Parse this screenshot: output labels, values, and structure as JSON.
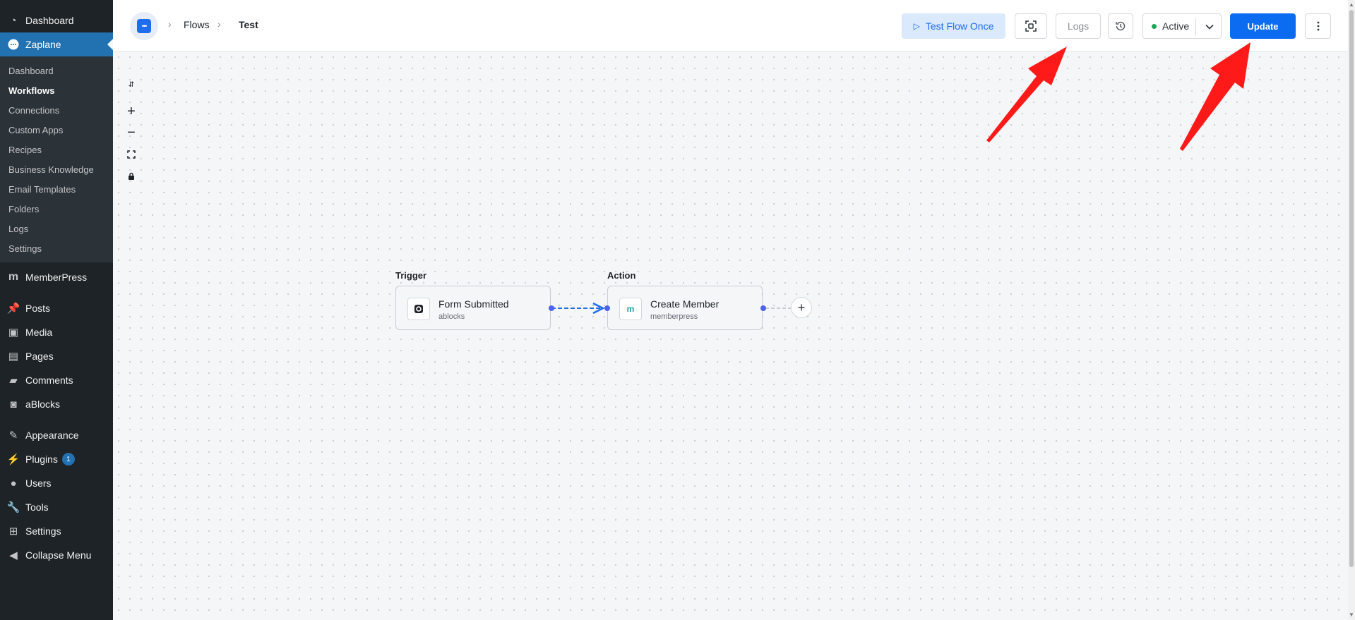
{
  "sidebar": {
    "top": [
      {
        "label": "Dashboard",
        "icon": "dashboard-icon"
      },
      {
        "label": "Zaplane",
        "icon": "zaplane-icon",
        "current": true
      }
    ],
    "submenu": [
      "Dashboard",
      "Workflows",
      "Connections",
      "Custom Apps",
      "Recipes",
      "Business Knowledge",
      "Email Templates",
      "Folders",
      "Logs",
      "Settings"
    ],
    "submenu_active": "Workflows",
    "bottom": [
      {
        "label": "MemberPress",
        "icon": "memberpress-icon"
      },
      {
        "label": "Posts",
        "icon": "pin-icon"
      },
      {
        "label": "Media",
        "icon": "media-icon"
      },
      {
        "label": "Pages",
        "icon": "pages-icon"
      },
      {
        "label": "Comments",
        "icon": "comment-icon"
      },
      {
        "label": "aBlocks",
        "icon": "ablocks-icon"
      },
      {
        "label": "Appearance",
        "icon": "brush-icon"
      },
      {
        "label": "Plugins",
        "icon": "plugin-icon",
        "badge": "1"
      },
      {
        "label": "Users",
        "icon": "user-icon"
      },
      {
        "label": "Tools",
        "icon": "wrench-icon"
      },
      {
        "label": "Settings",
        "icon": "settings-icon"
      },
      {
        "label": "Collapse Menu",
        "icon": "collapse-icon"
      }
    ]
  },
  "header": {
    "breadcrumbs": [
      "Flows",
      "Test"
    ],
    "test_flow_label": "Test Flow Once",
    "logs_label": "Logs",
    "status_label": "Active",
    "update_label": "Update"
  },
  "canvas": {
    "trigger_label": "Trigger",
    "action_label": "Action",
    "trigger_node": {
      "title": "Form Submitted",
      "subtitle": "ablocks"
    },
    "action_node": {
      "title": "Create Member",
      "subtitle": "memberpress"
    }
  },
  "colors": {
    "primary": "#0b6cf2",
    "sidebar": "#1d2327",
    "sidebar_current": "#2271b1",
    "status_active": "#22a35a",
    "annotation_arrow": "#ff1a1a"
  }
}
